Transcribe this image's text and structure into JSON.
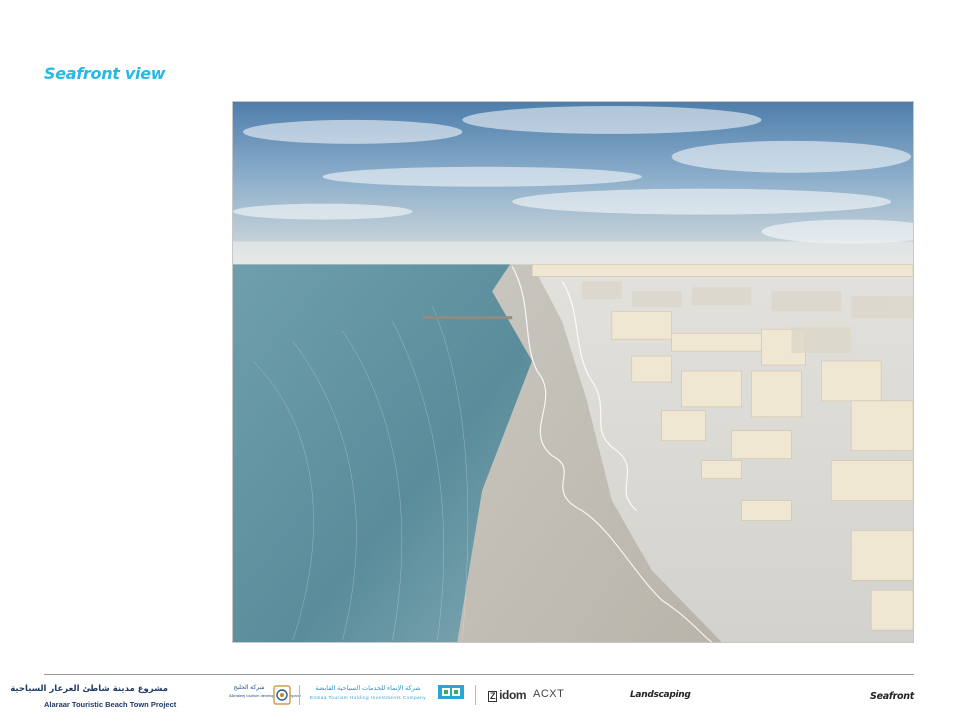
{
  "page": {
    "title": "Seafront view"
  },
  "hero_image": {
    "icon": "seafront-aerial-render-image"
  },
  "footer": {
    "project_name_arabic": "مشروع مدينة شاطئ العرعار السياحية",
    "project_name_english": "Alaraar Touristic Beach Town Project",
    "partner_logos": {
      "alkhaleej_arabic": "شركة الخليج",
      "alkhaleej_english": "Alkhaleej tourism development company",
      "emaa_arabic": "شركة الإنماء للخدمات السياحية القابضة",
      "emaa_english": "Enmaa Tourism Holding Investments Company",
      "emaa_mark_caption": "Emaa",
      "idom": "idom",
      "acxt": "ACXT"
    },
    "section_label": "Landscaping",
    "topic_label": "Seafront"
  },
  "colors": {
    "title_blue": "#27b8e8",
    "project_navy": "#1f3a64"
  }
}
